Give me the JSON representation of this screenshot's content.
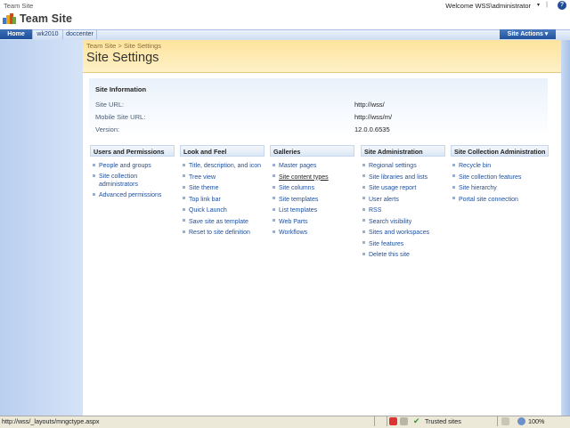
{
  "topbar": {
    "title": "Team Site",
    "welcome": "Welcome WSS\\administrator",
    "welcome_caret": "▾",
    "separator": "|",
    "help": "?"
  },
  "header": {
    "site_title": "Team Site"
  },
  "tabs": [
    {
      "label": "Home"
    },
    {
      "label": "wk2010"
    },
    {
      "label": "doccenter"
    }
  ],
  "site_actions": {
    "label": "Site Actions ▾"
  },
  "breadcrumb": {
    "root": "Team Site",
    "sep": ">",
    "current": "Site Settings"
  },
  "page_title": "Site Settings",
  "site_information": {
    "heading": "Site Information",
    "rows": [
      {
        "label": "Site URL:",
        "value": "http://wss/"
      },
      {
        "label": "Mobile Site URL:",
        "value": "http://wss/m/"
      },
      {
        "label": "Version:",
        "value": "12.0.0.6535"
      }
    ]
  },
  "columns": [
    {
      "heading": "Users and Permissions",
      "items": [
        "People and groups",
        "Site collection administrators",
        "Advanced permissions"
      ]
    },
    {
      "heading": "Look and Feel",
      "items": [
        "Title, description, and icon",
        "Tree view",
        "Site theme",
        "Top link bar",
        "Quick Launch",
        "Save site as template",
        "Reset to site definition"
      ]
    },
    {
      "heading": "Galleries",
      "items": [
        "Master pages",
        "Site content types",
        "Site columns",
        "Site templates",
        "List templates",
        "Web Parts",
        "Workflows"
      ]
    },
    {
      "heading": "Site Administration",
      "items": [
        "Regional settings",
        "Site libraries and lists",
        "Site usage report",
        "User alerts",
        "RSS",
        "Search visibility",
        "Sites and workspaces",
        "Site features",
        "Delete this site"
      ]
    },
    {
      "heading": "Site Collection Administration",
      "items": [
        "Recycle bin",
        "Site collection features",
        "Site hierarchy",
        "Portal site connection"
      ]
    }
  ],
  "collection_admins_lines": [
    "Site collection",
    "administrators"
  ],
  "status_bar": {
    "url": "http://wss/_layouts/mngctype.aspx",
    "zone": "Trusted sites",
    "zoom": "100%"
  },
  "colors": {
    "link": "#1e4f9c",
    "title_band": "#fde49c",
    "nav_blue": "#1d4f9b"
  }
}
